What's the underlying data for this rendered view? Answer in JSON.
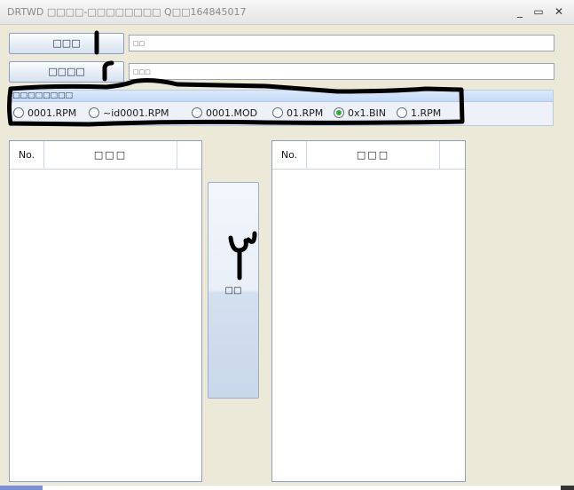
{
  "window": {
    "title": "DRTWD □□□□-□□□□□□□□ Q□□164845017",
    "minimize": "_",
    "maximize": "▭",
    "close": "✕"
  },
  "rows": [
    {
      "button_label": "□□□",
      "input_value": "□□"
    },
    {
      "button_label": "□□□□",
      "input_value": "□□□"
    }
  ],
  "group": {
    "title": "□□□□□□□□",
    "options": [
      {
        "label": "0001.RPM",
        "selected": false
      },
      {
        "label": "~id0001.RPM",
        "selected": false
      },
      {
        "label": "0001.MOD",
        "selected": false
      },
      {
        "label": "01.RPM",
        "selected": false
      },
      {
        "label": "0x1.BIN",
        "selected": true
      },
      {
        "label": "1.RPM",
        "selected": false
      }
    ]
  },
  "left_list": {
    "col_no": "No.",
    "col_name": "□□□"
  },
  "right_list": {
    "col_no": "No.",
    "col_name": "□□□"
  },
  "middle_button": {
    "label": "□□"
  },
  "colors": {
    "selected_radio": "#2fae34",
    "scribble": "#000000"
  }
}
